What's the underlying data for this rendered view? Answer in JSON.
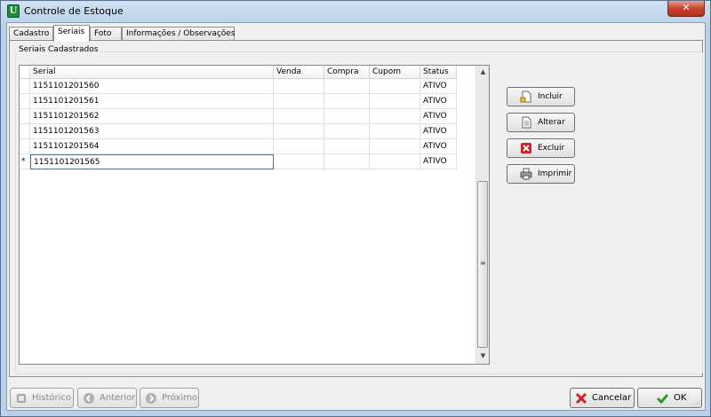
{
  "window": {
    "title": "Controle de Estoque",
    "close_glyph": "✕"
  },
  "tabs": [
    {
      "label": "Cadastro",
      "active": false
    },
    {
      "label": "Seriais",
      "active": true
    },
    {
      "label": "Foto",
      "active": false
    },
    {
      "label": "Informações / Observações",
      "active": false
    }
  ],
  "group": {
    "label": "Seriais Cadastrados"
  },
  "grid": {
    "columns": [
      "Serial",
      "Venda",
      "Compra",
      "Cupom",
      "Status"
    ],
    "rows": [
      {
        "indicator": "",
        "serial": "1151101201560",
        "venda": "",
        "compra": "",
        "cupom": "",
        "status": "ATIVO"
      },
      {
        "indicator": "",
        "serial": "1151101201561",
        "venda": "",
        "compra": "",
        "cupom": "",
        "status": "ATIVO"
      },
      {
        "indicator": "",
        "serial": "1151101201562",
        "venda": "",
        "compra": "",
        "cupom": "",
        "status": "ATIVO"
      },
      {
        "indicator": "",
        "serial": "1151101201563",
        "venda": "",
        "compra": "",
        "cupom": "",
        "status": "ATIVO"
      },
      {
        "indicator": "",
        "serial": "1151101201564",
        "venda": "",
        "compra": "",
        "cupom": "",
        "status": "ATIVO"
      },
      {
        "indicator": "*",
        "serial": "1151101201565",
        "venda": "",
        "compra": "",
        "cupom": "",
        "status": "ATIVO"
      }
    ],
    "scroll_up": "▲",
    "scroll_down": "▼",
    "grip": "≡"
  },
  "side_buttons": {
    "incluir": {
      "label": "Incluir",
      "icon": "new-document-icon"
    },
    "alterar": {
      "label": "Alterar",
      "icon": "edit-document-icon"
    },
    "excluir": {
      "label": "Excluir",
      "icon": "delete-icon"
    },
    "imprimir": {
      "label": "Imprimir",
      "icon": "printer-icon"
    }
  },
  "bottom_buttons": {
    "historico": {
      "label": "Histórico",
      "icon": "history-icon",
      "disabled": true
    },
    "anterior": {
      "label": "Anterior",
      "icon": "back-arrow-icon",
      "disabled": true
    },
    "proximo": {
      "label": "Próximo",
      "icon": "forward-arrow-icon",
      "disabled": true
    },
    "cancelar": {
      "label": "Cancelar",
      "icon": "red-x-icon"
    },
    "ok": {
      "label": "OK",
      "icon": "green-check-icon"
    }
  },
  "colors": {
    "app_icon": "#1e8a3c",
    "close_button": "#c7432a",
    "cancel_x": "#d0202a",
    "ok_check": "#2e9a2e"
  }
}
